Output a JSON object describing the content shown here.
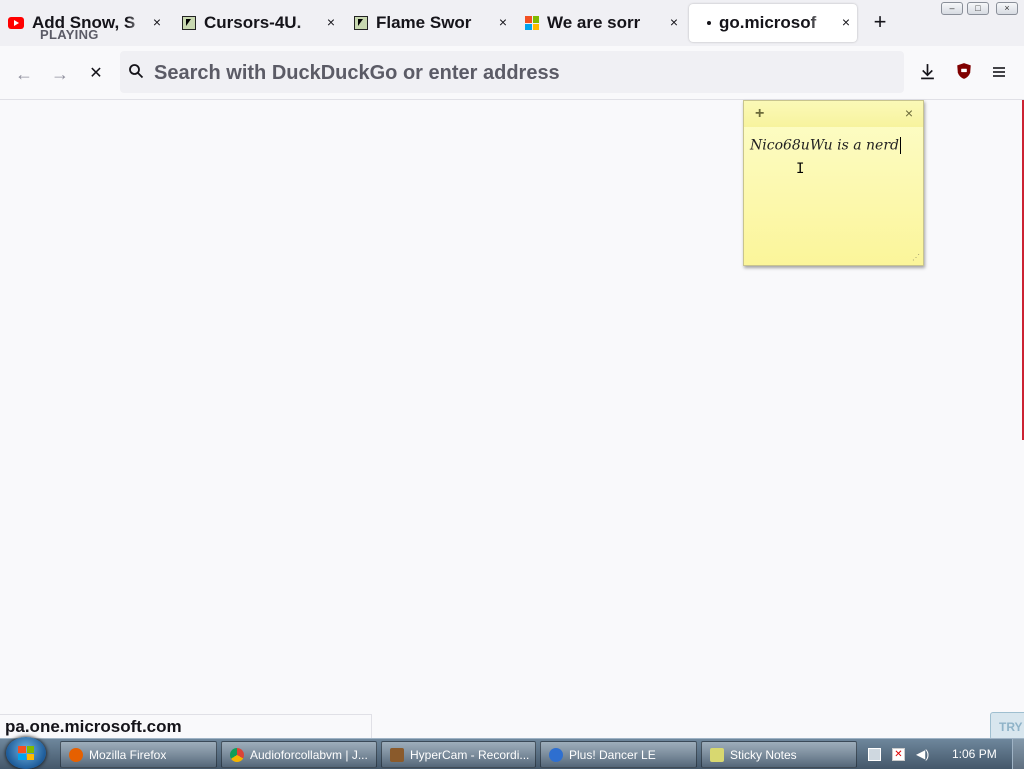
{
  "tabs": [
    {
      "title": "Add Snow, S",
      "subtitle": "PLAYING",
      "icon": "youtube-icon"
    },
    {
      "title": "Cursors-4U.",
      "icon": "cursor-icon"
    },
    {
      "title": "Flame Swor",
      "icon": "cursor-icon"
    },
    {
      "title": "We are sorr",
      "icon": "microsoft-icon"
    },
    {
      "title": "go.microsof",
      "icon": "loading-dot-icon"
    }
  ],
  "tab_close_glyph": "×",
  "new_tab_glyph": "+",
  "window_controls": {
    "minimize": "–",
    "maximize": "□",
    "close": "×"
  },
  "nav": {
    "back": "←",
    "forward": "→",
    "stop": "✕"
  },
  "urlbar": {
    "placeholder": "Search with DuckDuckGo or enter address"
  },
  "toolbar": {
    "download_icon": "download-icon",
    "extension_icon": "ublock-icon",
    "menu_icon": "hamburger-menu-icon"
  },
  "sticky_note": {
    "add": "+",
    "close": "×",
    "text": "Nico68uWu is a nerd"
  },
  "status": {
    "text": "pa.one.microsoft.com"
  },
  "try_badge": "TRY",
  "taskbar": {
    "items": [
      {
        "label": "Mozilla Firefox",
        "color": "#e66000"
      },
      {
        "label": "Audioforcollabvm | J...",
        "color": "#4285f4"
      },
      {
        "label": "HyperCam - Recordi...",
        "color": "#8a5a2b"
      },
      {
        "label": "Plus! Dancer LE",
        "color": "#2e6fd0"
      },
      {
        "label": "Sticky Notes",
        "color": "#d8d870"
      }
    ],
    "clock": "1:06 PM"
  },
  "colors": {
    "accent": "#15141a",
    "sticky": "#fbf59a",
    "taskbar": "#44576a"
  }
}
